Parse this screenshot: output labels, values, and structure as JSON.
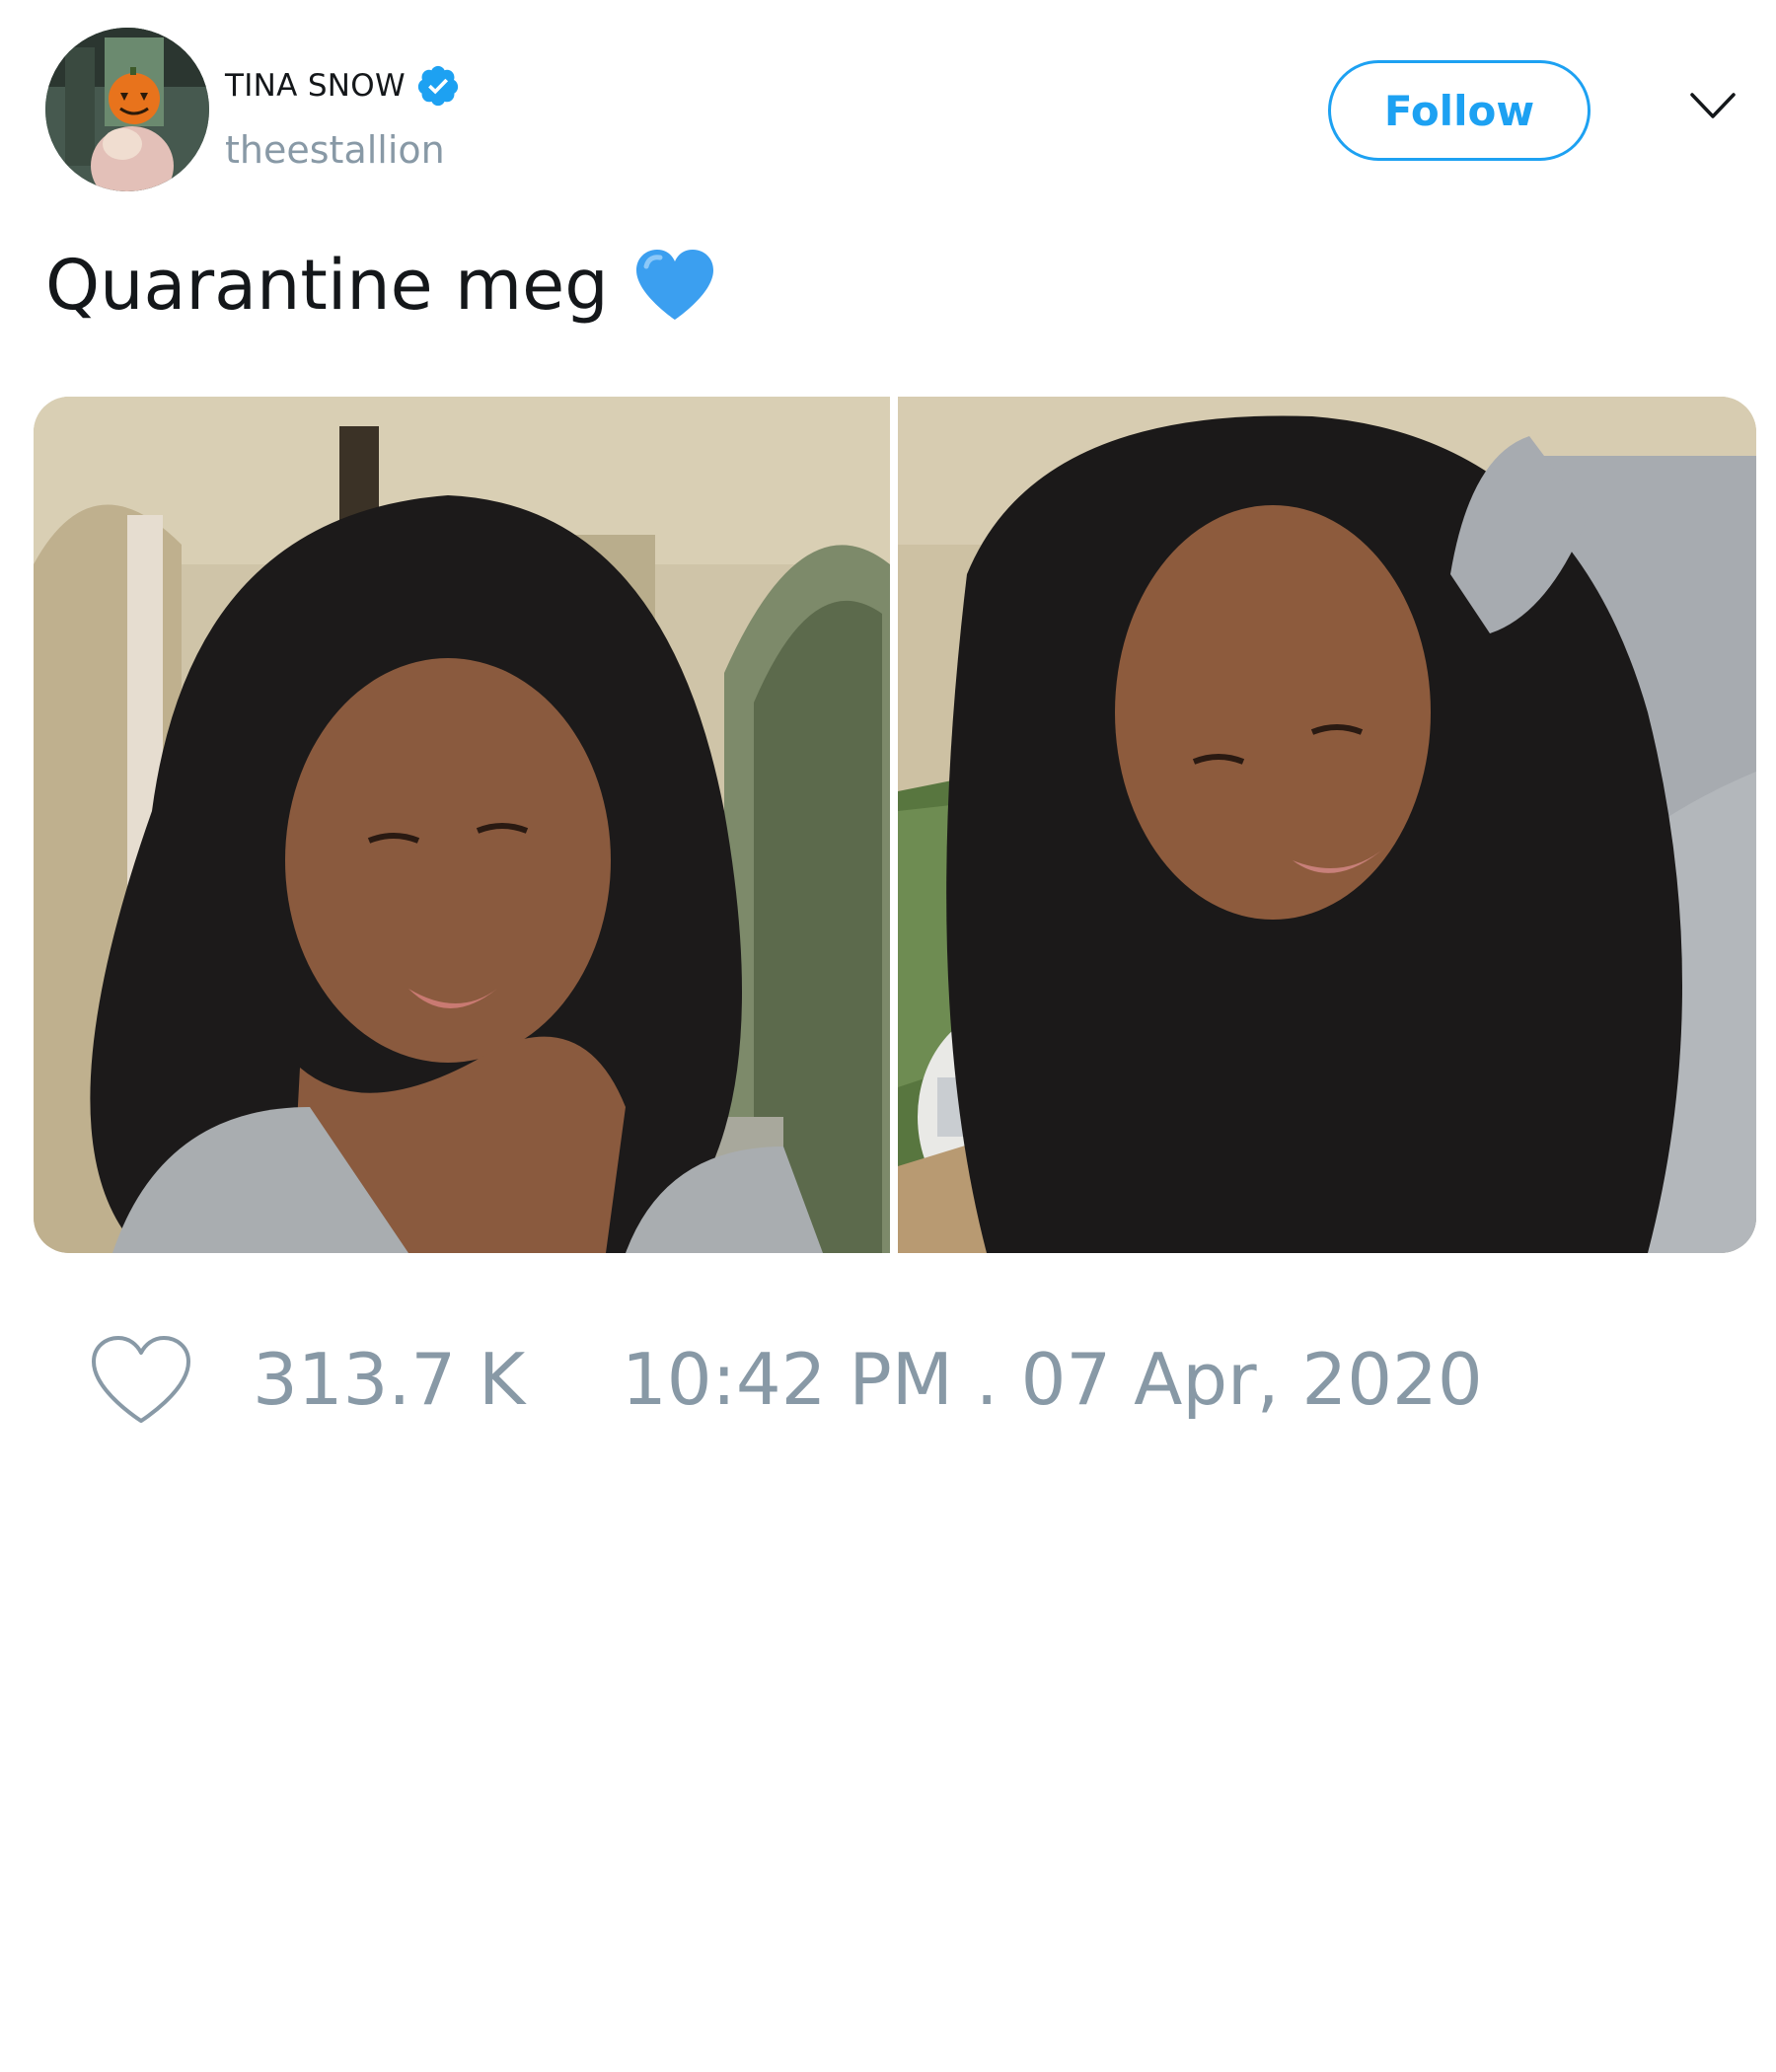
{
  "tweet": {
    "author": {
      "display_name": "TINA SNOW",
      "handle": "theestallion",
      "verified": true
    },
    "follow_label": "Follow",
    "text": "Quarantine meg",
    "text_emoji": "blue-heart",
    "media_count": 2,
    "likes": "313.7 K",
    "timestamp": "10:42 PM . 07 Apr, 2020"
  },
  "colors": {
    "accent": "#1da1f2",
    "muted_text": "#8899a6",
    "primary_text": "#14171a",
    "heart_emoji": "#3b9ff0"
  },
  "icons": [
    "verified-badge-icon",
    "chevron-down-icon",
    "blue-heart-emoji-icon",
    "heart-outline-icon"
  ]
}
